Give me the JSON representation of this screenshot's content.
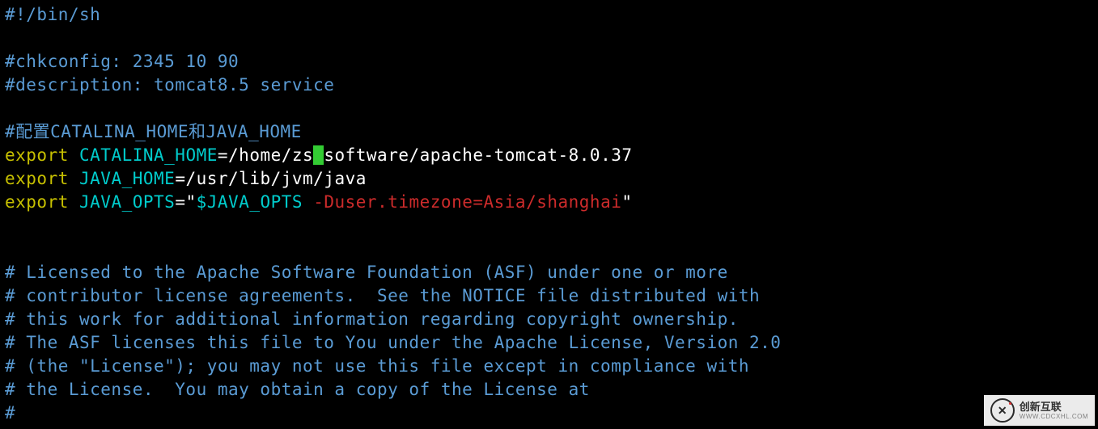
{
  "lines": {
    "shebang": "#!/bin/sh",
    "chk": "#chkconfig: 2345 10 90",
    "desc": "#description: tomcat8.5 service",
    "cn": "#配置CATALINA_HOME和JAVA_HOME",
    "exp": "export",
    "var_ch": "CATALINA_HOME",
    "eq1a": "=/home/zs",
    "cursor": "/",
    "eq1b": "software/apache-tomcat-8.0.37",
    "var_jh": "JAVA_HOME",
    "eq2": "=/usr/lib/jvm/java",
    "var_jo": "JAVA_OPTS",
    "eq3a": "=",
    "q1": "\"",
    "jo_dollar": "$JAVA_OPTS",
    "jo_red": " -Duser.timezone=Asia/shanghai",
    "q2": "\"",
    "lic1": "# Licensed to the Apache Software Foundation (ASF) under one or more",
    "lic2": "# contributor license agreements.  See the NOTICE file distributed with",
    "lic3": "# this work for additional information regarding copyright ownership.",
    "lic4": "# The ASF licenses this file to You under the Apache License, Version 2.0",
    "lic5": "# (the \"License\"); you may not use this file except in compliance with",
    "lic6": "# the License.  You may obtain a copy of the License at",
    "lic7": "#"
  },
  "logo": {
    "mark": "✕",
    "title": "创新互联",
    "sub": "WWW.CDCXHL.COM"
  }
}
